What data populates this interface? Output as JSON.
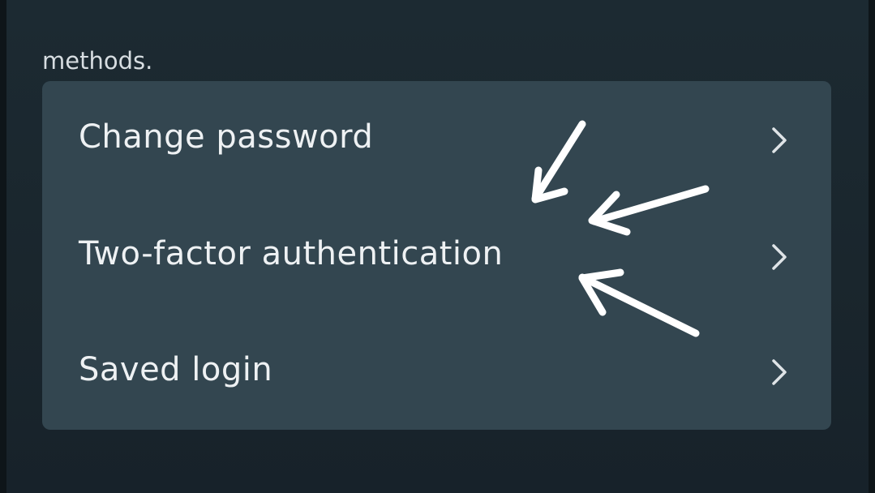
{
  "intro": {
    "text": "methods."
  },
  "settings_list": {
    "items": [
      {
        "label": "Change password",
        "icon": "chevron-right-icon"
      },
      {
        "label": "Two-factor authentication",
        "icon": "chevron-right-icon"
      },
      {
        "label": "Saved login",
        "icon": "chevron-right-icon"
      }
    ]
  },
  "annotation": {
    "arrow_color": "#ffffff",
    "arrows_target": "Two-factor authentication"
  },
  "colors": {
    "background": "#1c2a32",
    "card": "#334650",
    "text": "#eef1f3"
  }
}
